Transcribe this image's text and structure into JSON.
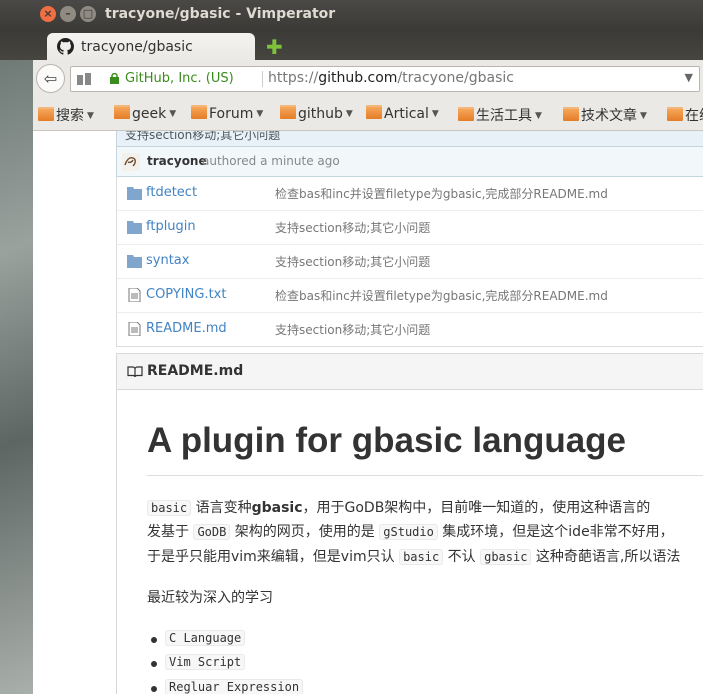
{
  "window": {
    "title": "tracyone/gbasic - Vimperator",
    "close": "×",
    "minimize": "–",
    "maximize": "□"
  },
  "tab": {
    "label": "tracyone/gbasic",
    "new_tab": "✚"
  },
  "navbar": {
    "back": "⇦",
    "identity": "GitHub, Inc. (US)",
    "url_scheme": "https://",
    "url_host": "github.com",
    "url_path": "/tracyone/gbasic",
    "dropdown": "▼"
  },
  "bookmarks": [
    {
      "label": "搜索"
    },
    {
      "label": "geek"
    },
    {
      "label": "Forum"
    },
    {
      "label": "github"
    },
    {
      "label": "Artical"
    },
    {
      "label": "生活工具"
    },
    {
      "label": "技术文章"
    },
    {
      "label": "在线"
    }
  ],
  "commit": {
    "message": "支持section移动;其它小问题",
    "author": "tracyone",
    "authored": "authored a minute ago"
  },
  "files": [
    {
      "type": "folder",
      "name": "ftdetect",
      "message": "检查bas和inc并设置filetype为gbasic,完成部分README.md"
    },
    {
      "type": "folder",
      "name": "ftplugin",
      "message": "支持section移动;其它小问题"
    },
    {
      "type": "folder",
      "name": "syntax",
      "message": "支持section移动;其它小问题"
    },
    {
      "type": "file",
      "name": "COPYING.txt",
      "message": "检查bas和inc并设置filetype为gbasic,完成部分README.md"
    },
    {
      "type": "file",
      "name": "README.md",
      "message": "支持section移动;其它小问题"
    }
  ],
  "readme": {
    "header": "README.md",
    "h1": "A plugin for gbasic language",
    "p1": {
      "code1": "basic",
      "t1": " 语言变种",
      "bold": "gbasic",
      "t2": "，用于GoDB架构中，目前唯一知道的，使用这种语言的"
    },
    "p2": {
      "t1": "发基于 ",
      "code1": "GoDB",
      "t2": " 架构的网页，使用的是 ",
      "code2": "gStudio",
      "t3": " 集成环境，但是这个ide非常不好用，"
    },
    "p3": {
      "t1": "于是乎只能用vim来编辑，但是vim只认 ",
      "code1": "basic",
      "t2": " 不认 ",
      "code2": "gbasic",
      "t3": " 这种奇葩语言,所以语法"
    },
    "p4": "最近较为深入的学习",
    "list": [
      "C Language",
      "Vim Script",
      "Regluar Expression"
    ]
  }
}
